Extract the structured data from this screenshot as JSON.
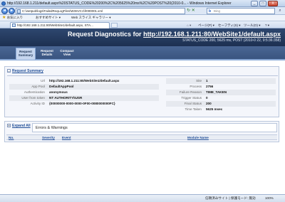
{
  "window": {
    "title": "http://192.168.1.211/default.aspx%20STATUS_CODE%20200%2C%205625%20ms%2C%20POST%20(2010-0... - Windows Internet Explorer",
    "minimize": "_",
    "maximize": "□",
    "close": "X"
  },
  "addressbar": {
    "url": "C:\\inetpub\\logs\\FailedReqLogFiles\\W3SVC1\\fr000001.xml",
    "search_placeholder": "Bing",
    "search_logo": "b"
  },
  "favorites": {
    "label": "お気に入り",
    "item1": "おすすめサイト ▾",
    "item2": "Web スライス ギャラリー ▾"
  },
  "tabbar": {
    "tab_title": "http://192.168.1.211:80/WebSite1/default.aspx, STA...",
    "cmd_page": "ページ(P) ▾",
    "cmd_safety": "セーフティ(S) ▾",
    "cmd_tools": "ツール(O) ▾",
    "cmd_help": "? ▾"
  },
  "report": {
    "title_prefix": "Request Diagnostics for ",
    "title_link": "http://192.168.1.211:80/WebSite1/default.aspx",
    "subtitle": "STATUS_CODE 200, 5625 ms, POST (2010-0 22, 9:5:36:358)",
    "nav": [
      {
        "label": "Request Summary"
      },
      {
        "label": "Request Details"
      },
      {
        "label": "Compact View"
      }
    ]
  },
  "summary": {
    "heading": "Request Summary",
    "left": [
      {
        "label": "Url",
        "value": "http://192.168.1.211:80/WebSite1/default.aspx"
      },
      {
        "label": "App Pool",
        "value": "DefaultAppPool"
      },
      {
        "label": "Authentication",
        "value": "anonymous"
      },
      {
        "label": "User from token",
        "value": "NT AUTHORITY\\IUSR"
      },
      {
        "label": "Activity ID",
        "value": "{00000000-0000-0000-0F00-0080000000FC}"
      }
    ],
    "right": [
      {
        "label": "Site",
        "value": "1"
      },
      {
        "label": "Process",
        "value": "2756"
      },
      {
        "label": "Failure Reason",
        "value": "TIME_TAKEN"
      },
      {
        "label": "Trigger Status",
        "value": "0"
      },
      {
        "label": "Final Status",
        "value": "200"
      },
      {
        "label": "Time Taken",
        "value": "5625 msec"
      }
    ]
  },
  "errors": {
    "expand_label": "Expand All",
    "title": "Errors & Warnings",
    "columns": [
      "No.",
      "Severity",
      "Event",
      "Module Name"
    ]
  },
  "statusbar": {
    "zone": "信頼済みサイト | 保護モード: 無効",
    "zoom": "100%"
  }
}
